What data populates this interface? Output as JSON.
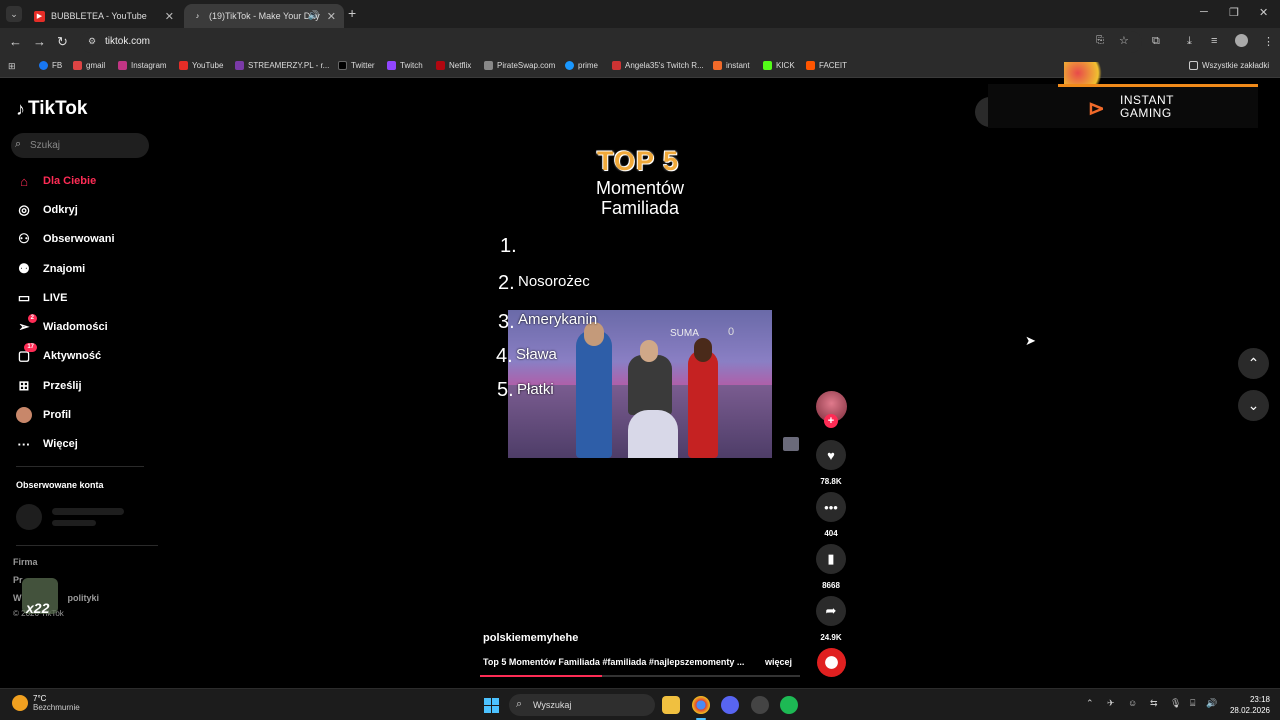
{
  "browser": {
    "tabs": [
      {
        "title": "BUBBLETEA - YouTube"
      },
      {
        "title": "(19)TikTok - Make Your Day"
      }
    ],
    "url": "tiktok.com",
    "bookmarks": [
      "FB",
      "gmail",
      "Instagram",
      "YouTube",
      "STREAMERZY.PL - r...",
      "Twitter",
      "Twitch",
      "Netflix",
      "PirateSwap.com",
      "prime",
      "Angela35's Twitch R...",
      "instant",
      "KICK",
      "FACEIT"
    ],
    "all_bookmarks": "Wszystkie zakładki"
  },
  "tiktok": {
    "logo": "TikTok",
    "search_placeholder": "Szukaj",
    "nav": [
      {
        "label": "Dla Ciebie",
        "icon": "home-icon",
        "active": true
      },
      {
        "label": "Odkryj",
        "icon": "compass-icon"
      },
      {
        "label": "Obserwowani",
        "icon": "following-icon"
      },
      {
        "label": "Znajomi",
        "icon": "friends-icon"
      },
      {
        "label": "LIVE",
        "icon": "live-icon"
      },
      {
        "label": "Wiadomości",
        "icon": "messages-icon",
        "badge": "2"
      },
      {
        "label": "Aktywność",
        "icon": "activity-icon",
        "badge": "17"
      },
      {
        "label": "Prześlij",
        "icon": "upload-icon"
      },
      {
        "label": "Profil",
        "icon": "profile-icon"
      },
      {
        "label": "Więcej",
        "icon": "more-icon"
      }
    ],
    "followed_title": "Obserwowane konta",
    "footer": {
      "company": "Firma",
      "line2": "Pr",
      "line3a": "W",
      "line3b": "polityki",
      "line4": "© 2026 TikTok"
    },
    "watermark": "x22"
  },
  "video": {
    "overlay_title": "TOP 5",
    "subtitle_1": "Momentów",
    "subtitle_2": "Familiada",
    "list": [
      {
        "num": "1.",
        "text": ""
      },
      {
        "num": "2.",
        "text": "Nosorożec"
      },
      {
        "num": "3.",
        "text": "Amerykanin"
      },
      {
        "num": "4.",
        "text": "Sława"
      },
      {
        "num": "5.",
        "text": "Płatki"
      }
    ],
    "clip": {
      "suma": "SUMA",
      "score": "0"
    },
    "author": "polskiememyhehe",
    "description": "Top 5 Momentów Familiada #familiada #najlepszemomenty ...",
    "more": "więcej",
    "progress": 0.38
  },
  "actions": {
    "likes": "78.8K",
    "comments": "404",
    "saves": "8668",
    "shares": "24.9K"
  },
  "ad_overlay": {
    "line1": "INSTANT",
    "line2": "GAMING"
  },
  "taskbar": {
    "temp": "7°C",
    "weather": "Bezchmurnie",
    "search": "Wyszukaj",
    "time": "23:18",
    "date": "28.02.2026"
  },
  "colors": {
    "accent": "#fe2c55",
    "background": "#000000"
  }
}
